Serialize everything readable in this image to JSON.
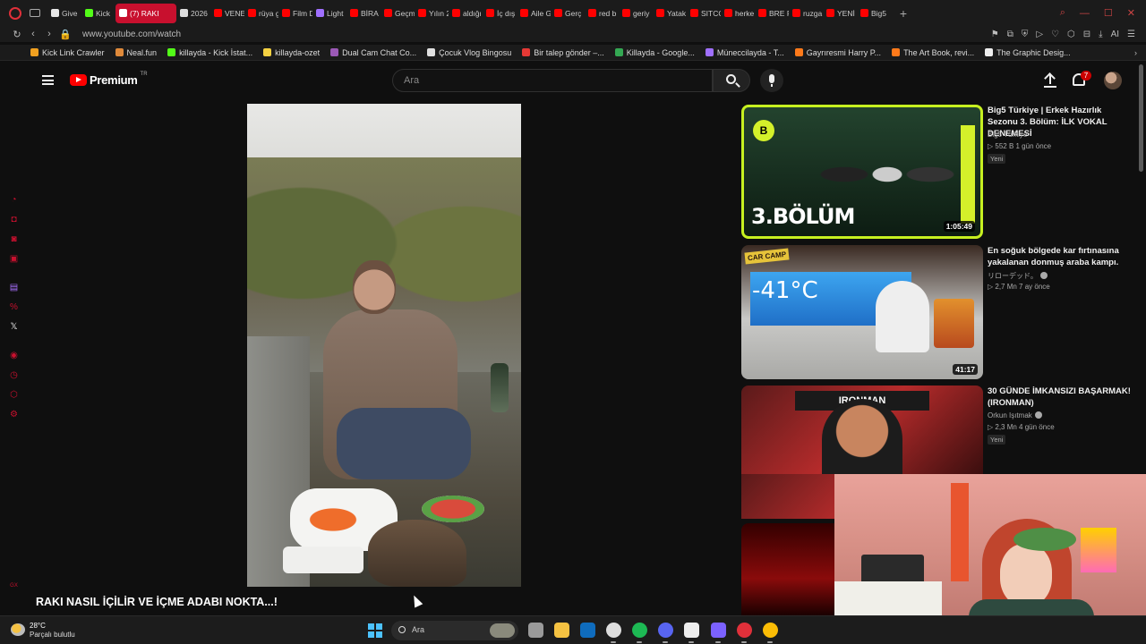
{
  "browser": {
    "tabs": [
      {
        "label": "Give",
        "color": "#e8e8e8"
      },
      {
        "label": "Kick",
        "color": "#53fc18"
      },
      {
        "label": "(7) RAKI",
        "color": "#ffffff",
        "active": true
      },
      {
        "label": "2026",
        "color": "#dddddd"
      },
      {
        "label": "VENE",
        "color": "#ff0000"
      },
      {
        "label": "rüya g",
        "color": "#ff0000"
      },
      {
        "label": "Film D",
        "color": "#ff0000"
      },
      {
        "label": "Light",
        "color": "#a070ff"
      },
      {
        "label": "BİRA",
        "color": "#ff0000"
      },
      {
        "label": "Geçm",
        "color": "#ff0000"
      },
      {
        "label": "Yılın 2",
        "color": "#ff0000"
      },
      {
        "label": "aldığı",
        "color": "#ff0000"
      },
      {
        "label": "İç dış",
        "color": "#ff0000"
      },
      {
        "label": "Aile G",
        "color": "#ff0000"
      },
      {
        "label": "Gerç",
        "color": "#ff0000"
      },
      {
        "label": "red b",
        "color": "#ff0000"
      },
      {
        "label": "geriy",
        "color": "#ff0000"
      },
      {
        "label": "Yatak",
        "color": "#ff0000"
      },
      {
        "label": "SITCO",
        "color": "#ff0000"
      },
      {
        "label": "herke",
        "color": "#ff0000"
      },
      {
        "label": "BRE F",
        "color": "#ff0000"
      },
      {
        "label": "ruzga",
        "color": "#ff0000"
      },
      {
        "label": "YENİ",
        "color": "#ff0000"
      },
      {
        "label": "Big5",
        "color": "#ff0000"
      }
    ],
    "url": "www.youtube.com/watch",
    "bookmarks": [
      {
        "label": "Kick Link Crawler",
        "color": "#f0a020"
      },
      {
        "label": "Neal.fun",
        "color": "#e08a3a"
      },
      {
        "label": "killayda - Kick İstat...",
        "color": "#53fc18"
      },
      {
        "label": "killayda-ozet",
        "color": "#f5d142"
      },
      {
        "label": "Dual Cam Chat Co...",
        "color": "#9b59b6"
      },
      {
        "label": "Çocuk Vlog Bingosu",
        "color": "#e0e0e0"
      },
      {
        "label": "Bir talep gönder –...",
        "color": "#e53935"
      },
      {
        "label": "Killayda - Google...",
        "color": "#34a853"
      },
      {
        "label": "Müneccilayda - T...",
        "color": "#a070ff"
      },
      {
        "label": "Gayrıresmi Harry P...",
        "color": "#ff7a1a"
      },
      {
        "label": "The Art Book, revi...",
        "color": "#ff7a1a"
      },
      {
        "label": "The Graphic Desig...",
        "color": "#eeeeee"
      }
    ]
  },
  "youtube": {
    "logo_text": "Premium",
    "region": "TR",
    "search_placeholder": "Ara",
    "notification_count": "7",
    "video_title": "RAKI NASIL İÇİLİR VE İÇME ADABI NOKTA...!",
    "recommendations": [
      {
        "title": "Big5 Türkiye | Erkek Hazırlık Sezonu 3. Bölüm: İLK VOKAL DENEMESİ",
        "channel": "Big5 Türkiye",
        "meta": "▷ 552 B   1 gün önce",
        "badge": "Yeni",
        "duration": "1:05:49",
        "thumb_logo": "B",
        "thumb_text": "3.BÖLÜM",
        "verified": false
      },
      {
        "title": "En soğuk bölgede kar fırtınasına yakalanan donmuş araba kampı.",
        "channel": "リローデッド。",
        "meta": "▷ 2,7 Mn   7 ay önce",
        "badge": "",
        "duration": "41:17",
        "thumb_label": "CAR CAMP",
        "thumb_text": "-41°C",
        "verified": true
      },
      {
        "title": "30 GÜNDE İMKANSIZI BAŞARMAK! (IRONMAN)",
        "channel": "Orkun Işıtmak",
        "meta": "▷ 2,3 Mn   4 gün önce",
        "badge": "Yeni",
        "duration": "",
        "thumb_text": "IRONMAN",
        "verified": true
      }
    ]
  },
  "taskbar": {
    "temperature": "28°C",
    "weather": "Parçalı bulutlu",
    "search_label": "Ara",
    "apps": [
      {
        "name": "task-view-icon",
        "color": "#9a9a9a"
      },
      {
        "name": "file-explorer-icon",
        "color": "#f5c242"
      },
      {
        "name": "outlook-icon",
        "color": "#0f6cbd"
      },
      {
        "name": "chatgpt-icon",
        "color": "#dddddd"
      },
      {
        "name": "spotify-icon",
        "color": "#1db954"
      },
      {
        "name": "discord-icon",
        "color": "#5865f2"
      },
      {
        "name": "app-g-icon",
        "color": "#eeeeee"
      },
      {
        "name": "app-grid-icon",
        "color": "#7b61ff"
      },
      {
        "name": "opera-gx-icon",
        "color": "#e0303a"
      },
      {
        "name": "chrome-icon",
        "color": "#fbbc05"
      }
    ]
  }
}
